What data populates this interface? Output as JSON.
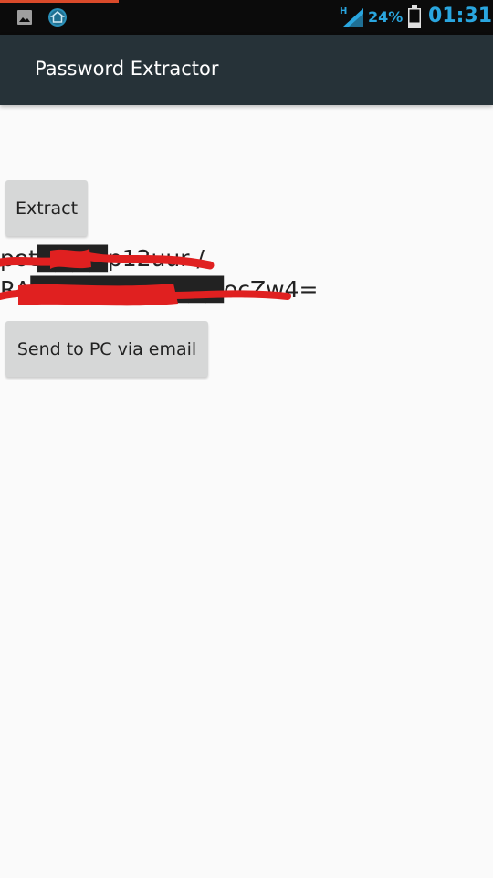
{
  "status_bar": {
    "battery_percent": "24%",
    "time": "01:31",
    "network_type": "H",
    "accent_color": "#2aa6df",
    "icons": [
      "gallery-icon",
      "home-app-icon",
      "signal-icon",
      "battery-icon"
    ]
  },
  "app_bar": {
    "title": "Password Extractor",
    "background_color": "#263238"
  },
  "main": {
    "extract_button_label": "Extract",
    "result_lines": [
      "pot████p12uur /",
      "RA███████████ocZw4="
    ],
    "send_button_label": "Send to PC via email",
    "redaction_color": "#e02020"
  }
}
